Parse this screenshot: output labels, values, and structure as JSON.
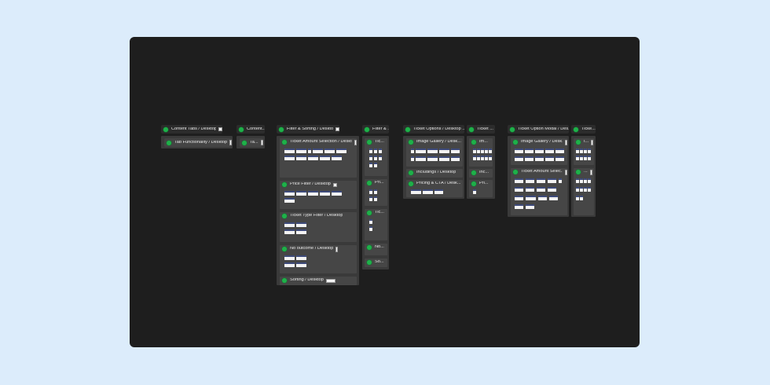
{
  "canvas": {
    "frames": [
      {
        "id": "content-tabs",
        "title": "Content Tabs / Desktop",
        "children": [
          {
            "label": "Tab Functionality / Desktop"
          }
        ]
      },
      {
        "id": "content-narrow",
        "title": "Content...",
        "children": [
          {
            "label": "Ta..."
          }
        ]
      },
      {
        "id": "filter-sorting",
        "title": "Filter & Sorting / Desktop",
        "children": [
          {
            "label": "Ticket Amount Selection / Deskt..."
          },
          {
            "label": "Price Filter / Desktop"
          },
          {
            "label": "Ticket Type Filter / Desktop"
          },
          {
            "label": "No outcome / Desktop"
          },
          {
            "label": "Sorting / Desktop"
          }
        ]
      },
      {
        "id": "filter-narrow",
        "title": "Filter & ...",
        "children": [
          {
            "label": "Tic..."
          },
          {
            "label": "Pri..."
          },
          {
            "label": "Tic..."
          },
          {
            "label": "No..."
          },
          {
            "label": "So..."
          }
        ]
      },
      {
        "id": "ticket-options",
        "title": "Ticket Options / Desktop ...",
        "children": [
          {
            "label": "Image Gallery / Desk..."
          },
          {
            "label": "Includings / Desktop"
          },
          {
            "label": "Pricing & CTA / Desk..."
          }
        ]
      },
      {
        "id": "ticket-narrow",
        "title": "Ticket ...",
        "children": [
          {
            "label": "Im..."
          },
          {
            "label": "Inc..."
          },
          {
            "label": "Pri..."
          }
        ]
      },
      {
        "id": "ticket-modal",
        "title": "Ticket Option Modal / Des...",
        "children": [
          {
            "label": "Image Gallery / Desk..."
          },
          {
            "label": "Ticket Amount Selec..."
          }
        ]
      },
      {
        "id": "ticket-modal-narrow",
        "title": "Ticke...",
        "children": [
          {
            "label": "I..."
          },
          {
            "label": "..."
          }
        ]
      }
    ]
  },
  "colors": {
    "page_bg": "#dcecfb",
    "canvas_bg": "#1e1e1e",
    "status_dot": "#1fb04a"
  }
}
